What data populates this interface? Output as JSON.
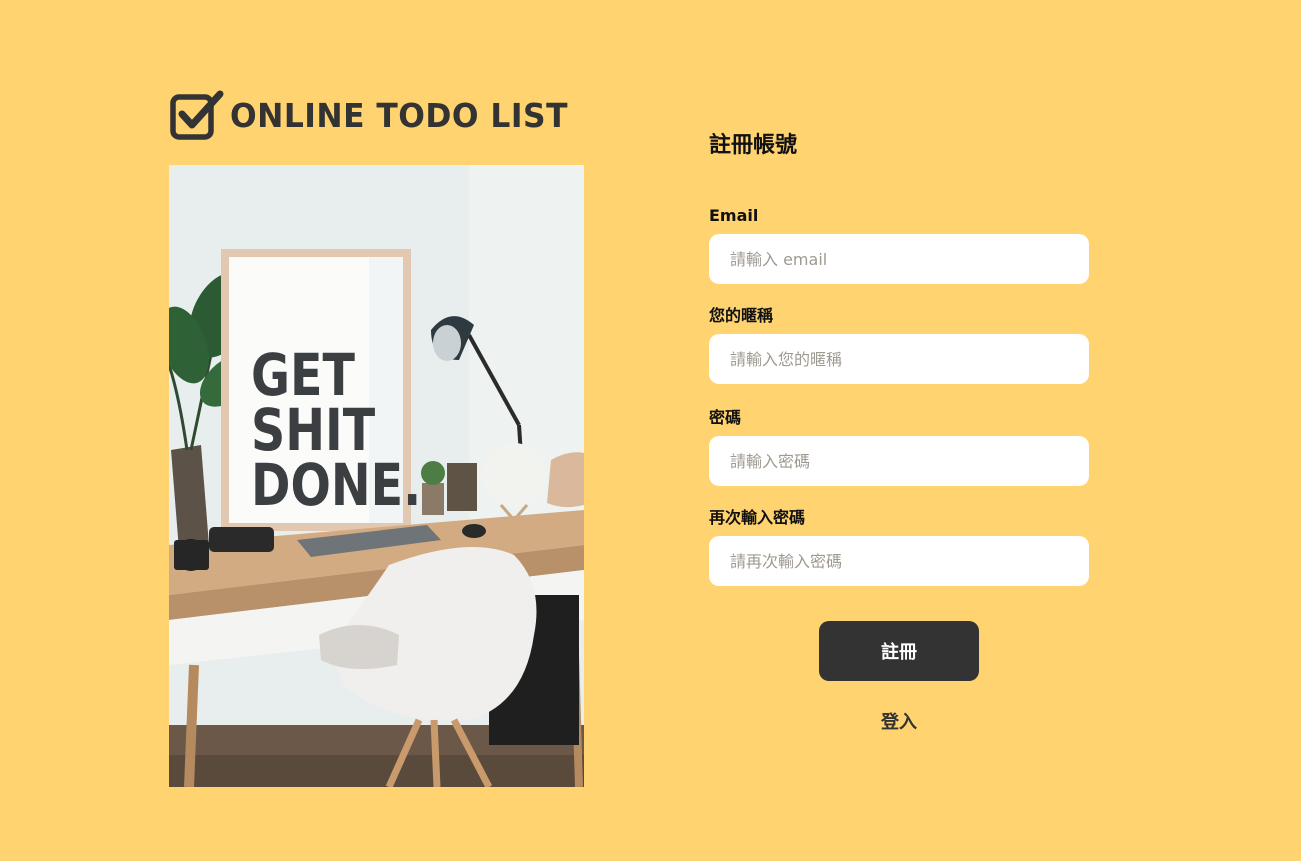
{
  "brand": {
    "logo_icon": "checkbox-check-icon",
    "name": "ONLINE TODO LIST"
  },
  "hero_image": {
    "poster_lines": [
      "GET",
      "SHIT",
      "DONE."
    ]
  },
  "signup_form": {
    "title": "註冊帳號",
    "email": {
      "label": "Email",
      "placeholder": "請輸入 email",
      "value": ""
    },
    "nickname": {
      "label": "您的暱稱",
      "placeholder": "請輸入您的暱稱",
      "value": ""
    },
    "password": {
      "label": "密碼",
      "placeholder": "請輸入密碼",
      "value": ""
    },
    "confirm_password": {
      "label": "再次輸入密碼",
      "placeholder": "請再次輸入密碼",
      "value": ""
    },
    "submit_label": "註冊",
    "login_link_label": "登入"
  },
  "colors": {
    "background": "#FFD370",
    "text_dark": "#333333",
    "input_background": "#FFFFFF",
    "placeholder": "#9F9A91"
  }
}
